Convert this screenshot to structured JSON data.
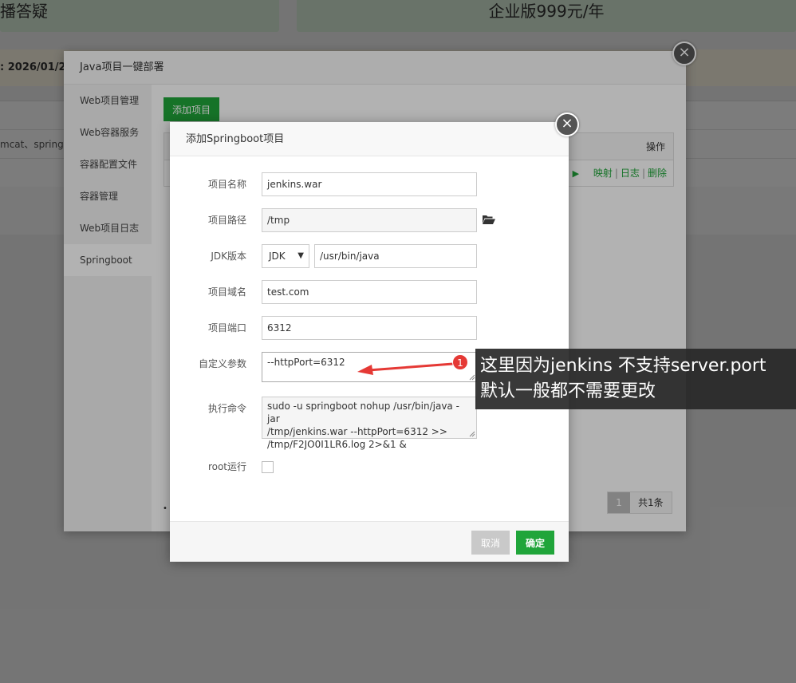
{
  "background": {
    "card_left": "播答疑",
    "card_right": "企业版999元/年",
    "notice": ": 2026/01/2",
    "table_row": "mcat、spring"
  },
  "outer_dialog": {
    "title": "Java项目一键部署",
    "close_glyph": "×",
    "sidebar": [
      {
        "label": "Web项目管理"
      },
      {
        "label": "Web容器服务"
      },
      {
        "label": "容器配置文件"
      },
      {
        "label": "容器管理"
      },
      {
        "label": "Web项目日志"
      },
      {
        "label": "Springboot",
        "active": true
      }
    ],
    "add_button": "添加项目",
    "table_header_ops": "操作",
    "row_actions": {
      "map": "映射",
      "log": "日志",
      "delete": "删除",
      "sep": "|"
    },
    "pager": {
      "current": "1",
      "total": "共1条"
    },
    "bullet": "•"
  },
  "inner_dialog": {
    "title": "添加Springboot项目",
    "close_glyph": "×",
    "fields": {
      "name": {
        "label": "项目名称",
        "value": "jenkins.war"
      },
      "path": {
        "label": "项目路径",
        "value": "/tmp"
      },
      "jdk": {
        "label": "JDK版本",
        "select": "JDK",
        "value": "/usr/bin/java"
      },
      "domain": {
        "label": "项目域名",
        "value": "test.com"
      },
      "port": {
        "label": "项目端口",
        "value": "6312"
      },
      "custom": {
        "label": "自定义参数",
        "value": "--httpPort=6312"
      },
      "command": {
        "label": "执行命令",
        "line1": "sudo -u springboot nohup /usr/bin/java -jar",
        "line2": "/tmp/jenkins.war  --httpPort=6312  >>",
        "line3": "/tmp/F2JO0I1LR6.log 2>&1 &"
      },
      "root": {
        "label": "root运行"
      }
    },
    "cancel": "取消",
    "ok": "确定"
  },
  "annotation": {
    "badge": "1",
    "line1": "这里因为jenkins 不支持server.port",
    "line2": "默认一般都不需要更改"
  },
  "colors": {
    "accent": "#20a53a",
    "badge": "#e53935"
  }
}
